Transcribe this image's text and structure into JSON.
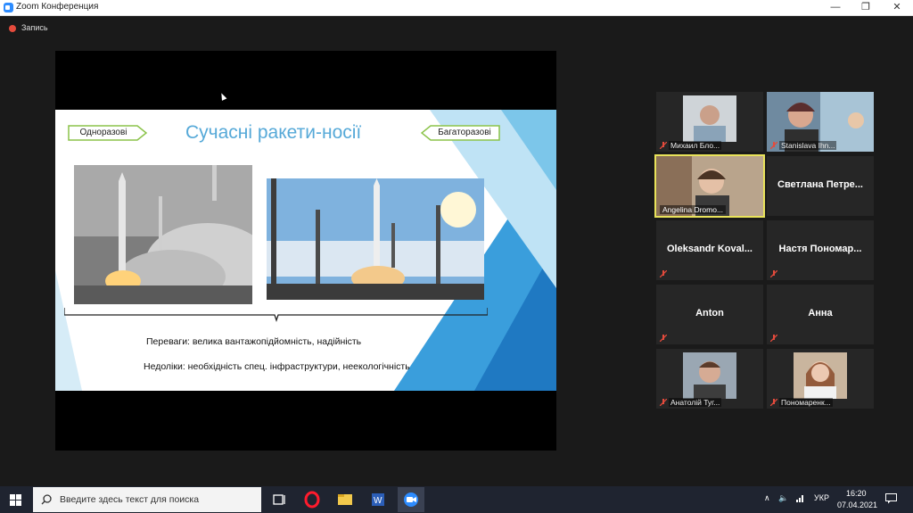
{
  "window": {
    "title": "Zoom Конференция",
    "minimize": "—",
    "maximize": "❐",
    "close": "✕"
  },
  "recording": {
    "label": "Запись"
  },
  "slide": {
    "title": "Сучасні ракети-носії",
    "left_arrow": "Одноразові",
    "right_arrow": "Багаторазові",
    "advantages": "Переваги: велика вантажопідйомність, надійність",
    "disadvantages": "Недоліки: необхідність спец. інфраструктури, неекологічність"
  },
  "participants": [
    {
      "name": "Михаил Бло...",
      "video": true
    },
    {
      "name": "Stanislava Ihn...",
      "video": true
    },
    {
      "name": "Angelina Dromo...",
      "video": true,
      "active": true
    },
    {
      "name": "Светлана Петре...",
      "video": false
    },
    {
      "name": "Oleksandr Koval...",
      "video": false
    },
    {
      "name": "Настя Пономар...",
      "video": false
    },
    {
      "name": "Anton",
      "video": false
    },
    {
      "name": "Анна",
      "video": false
    },
    {
      "name": "Анатолій Туг...",
      "video": true
    },
    {
      "name": "Пономаренк...",
      "video": true
    }
  ],
  "taskbar": {
    "search_placeholder": "Введите здесь текст для поиска",
    "language": "УКР",
    "time": "16:20",
    "date": "07.04.2021"
  },
  "colors": {
    "accent_blue": "#2d8cff",
    "slide_title": "#56a9d8",
    "active_speaker": "#e9e35a",
    "mic_muted": "#e54b3c"
  }
}
